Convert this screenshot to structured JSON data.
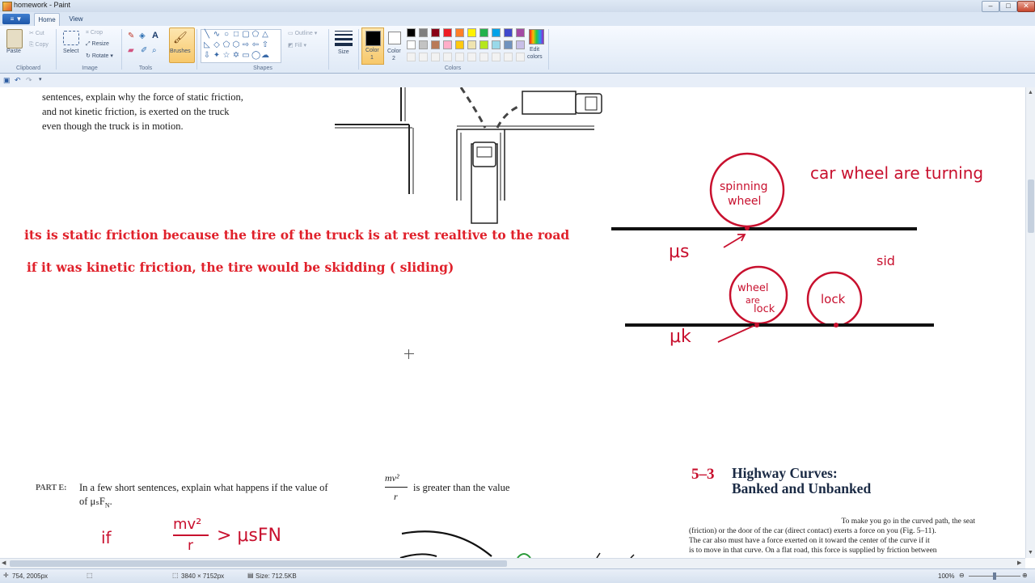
{
  "window": {
    "title": "homework - Paint",
    "buttons": [
      "–",
      "□",
      "✕"
    ]
  },
  "tabs": {
    "file": "▼",
    "items": [
      "Home",
      "View"
    ]
  },
  "ribbon": {
    "clipboard": {
      "paste": "Paste",
      "cut": "Cut",
      "copy": "Copy",
      "label": "Clipboard"
    },
    "image": {
      "select": "Select",
      "crop": "Crop",
      "resize": "Resize",
      "rotate": "Rotate",
      "label": "Image"
    },
    "tools": {
      "label": "Tools",
      "brushes": "Brushes"
    },
    "shapes": {
      "outline": "Outline",
      "fill": "Fill",
      "label": "Shapes"
    },
    "size": {
      "label": "Size"
    },
    "colors": {
      "color1": "Color\n1",
      "color1_a": "Color",
      "color1_b": "1",
      "color2_a": "Color",
      "color2_b": "2",
      "edit_a": "Edit",
      "edit_b": "colors",
      "label": "Colors",
      "palette_row1": [
        "#000000",
        "#7f7f7f",
        "#880015",
        "#ed1c24",
        "#ff7f27",
        "#fff200",
        "#22b14c",
        "#00a2e8",
        "#3f48cc",
        "#a349a4"
      ],
      "palette_row2": [
        "#ffffff",
        "#c3c3c3",
        "#b97a57",
        "#ffaec9",
        "#ffc90e",
        "#efe4b0",
        "#b5e61d",
        "#99d9ea",
        "#7092be",
        "#c8bfe7"
      ]
    }
  },
  "document": {
    "question_text": [
      "sentences, explain why the force of static friction,",
      "and not kinetic friction, is exerted on the truck",
      "even though the truck is in motion."
    ],
    "answer_line1": "its is static friction because the tire of the truck is at rest realtive to the road",
    "answer_line2": "if it was kinetic friction, the tire would be skidding ( sliding)",
    "part_e_label": "PART E:",
    "part_e_text_a": "In a few short sentences, explain what happens if the value of",
    "part_e_frac_num": "mv²",
    "part_e_frac_den": "r",
    "part_e_text_b": "is greater than the value",
    "part_e_text_c": "of μₛF",
    "part_e_text_c_sub": "N",
    "part_e_text_c_end": ".",
    "handwritten": {
      "spinning_a": "spinning",
      "spinning_b": "wheel",
      "turning": "car wheel are turning",
      "mu_s": "μs",
      "side": "sid",
      "wheel_lock_a": "wheel",
      "wheel_lock_b": "are",
      "wheel_lock_c": "lock",
      "lock": "lock",
      "mu_k": "μk",
      "if": "if",
      "ineq_num": "mv²",
      "ineq_den": "r",
      "ineq_rest": "> μsFN"
    },
    "textbook": {
      "section_num": "5–3",
      "section_title_1": "Highway Curves:",
      "section_title_2": "Banked and Unbanked",
      "para": [
        "To make you go in the curved path, the seat",
        "(friction) or the door of the car (direct contact) exerts a force on you (Fig. 5–11).",
        "The car also must have a force exerted on it toward the center of the curve if it",
        "is to move in that curve. On a flat road, this force is supplied by friction between"
      ]
    }
  },
  "status": {
    "cursor_pos": "754, 2005px",
    "dimensions": "3840 × 7152px",
    "size": "Size: 712.5KB",
    "zoom": "100%"
  }
}
